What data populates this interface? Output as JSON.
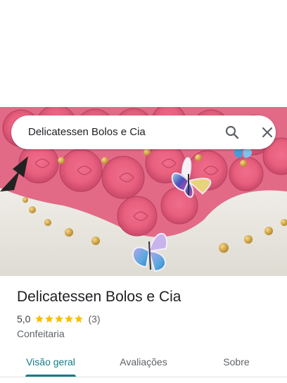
{
  "search": {
    "query": "Delicatessen Bolos e Cia",
    "search_icon": "search-icon",
    "close_icon": "close-icon"
  },
  "hero": {
    "image": "photo-of-cake-with-pink-rosettes-and-butterflies"
  },
  "place": {
    "title": "Delicatessen Bolos e Cia",
    "rating": "5,0",
    "stars": 5,
    "review_count": "(3)",
    "category": "Confeitaria"
  },
  "tabs": [
    {
      "label": "Visão geral",
      "active": true
    },
    {
      "label": "Avaliações",
      "active": false
    },
    {
      "label": "Sobre",
      "active": false
    }
  ],
  "colors": {
    "accent": "#137c86",
    "star": "#fbbc04",
    "title": "#202124",
    "secondary_text": "#5f6368"
  }
}
